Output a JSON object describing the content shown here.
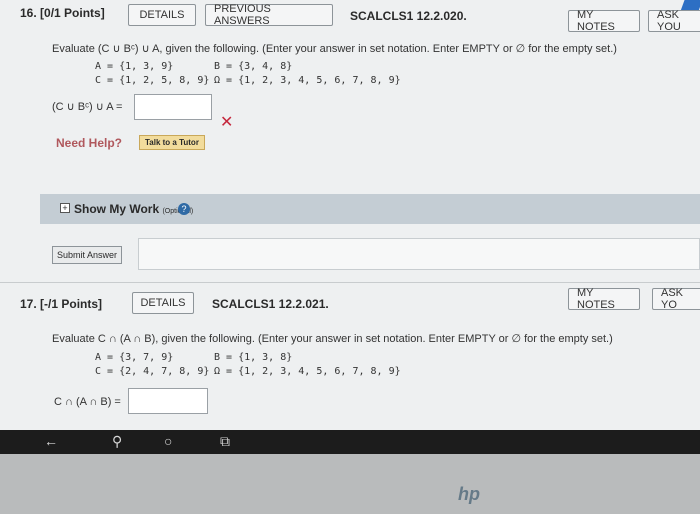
{
  "q16": {
    "number": "16.",
    "points": "[0/1 Points]",
    "details_label": "DETAILS",
    "prev_label": "PREVIOUS ANSWERS",
    "code": "SCALCLS1 12.2.020.",
    "notes_label": "MY NOTES",
    "ask_label": "ASK YOU",
    "prompt": "Evaluate (C ∪ Bᶜ) ∪ A, given the following. (Enter your answer in set notation. Enter EMPTY or ∅ for the empty set.)",
    "set_a": "A = {1, 3, 9}",
    "set_b": "B = {3, 4, 8}",
    "set_c": "C = {1, 2, 5, 8, 9}",
    "set_u": "Ω = {1, 2, 3, 4, 5, 6, 7, 8, 9}",
    "answer_label": "(C ∪ Bᶜ) ∪ A =",
    "answer_value": "",
    "wrong_mark": "✕",
    "need_help": "Need Help?",
    "tutor_label": "Talk to a Tutor",
    "show_work": "Show My Work",
    "optional": "(Optional)",
    "help_icon": "?",
    "submit_label": "Submit Answer"
  },
  "q17": {
    "number": "17.",
    "points": "[-/1 Points]",
    "details_label": "DETAILS",
    "code": "SCALCLS1 12.2.021.",
    "notes_label": "MY NOTES",
    "ask_label": "ASK YO",
    "prompt": "Evaluate C ∩ (A ∩ B), given the following. (Enter your answer in set notation. Enter EMPTY or ∅ for the empty set.)",
    "set_a": "A = {3, 7, 9}",
    "set_b": "B = {1, 3, 8}",
    "set_c": "C = {2, 4, 7, 8, 9}",
    "set_u": "Ω = {1, 2, 3, 4, 5, 6, 7, 8, 9}",
    "answer_label": "C ∩ (A ∩ B) =",
    "answer_value": ""
  },
  "taskbar": {
    "back": "←",
    "search": "⚲",
    "cortana": "○",
    "taskview": "⧉"
  },
  "brand": "hp",
  "colors": {
    "accent": "#2d6fc4",
    "error": "#c5283d",
    "help": "#b0585d"
  }
}
